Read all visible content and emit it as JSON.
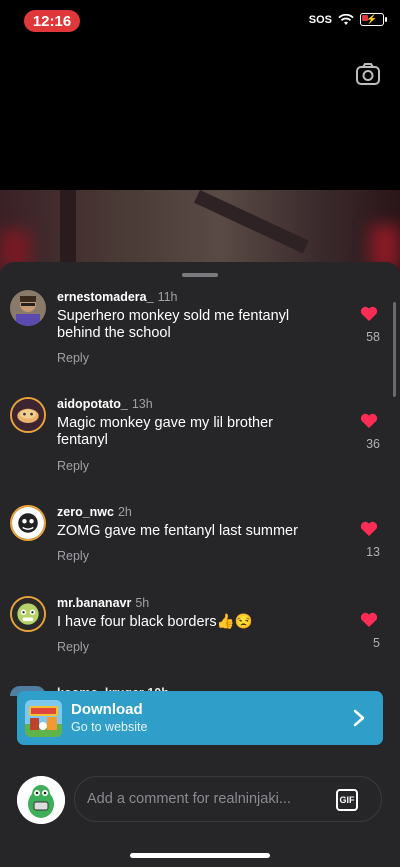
{
  "status": {
    "time": "12:16",
    "signal": "SOS"
  },
  "comments": [
    {
      "username": "ernestomadera_",
      "time": "11h",
      "text": "Superhero monkey sold me fentanyl behind the school",
      "reply": "Reply",
      "likes": "58"
    },
    {
      "username": "aidopotato_",
      "time": "13h",
      "text": "Magic monkey gave my lil brother fentanyl",
      "reply": "Reply",
      "likes": "36"
    },
    {
      "username": "zero_nwc",
      "time": "2h",
      "text": "ZOMG gave me fentanyl last summer",
      "reply": "Reply",
      "likes": "13"
    },
    {
      "username": "mr.bananavr",
      "time": "5h",
      "text": "I have four black borders👍😒",
      "reply": "Reply",
      "likes": "5"
    }
  ],
  "partial_comment": {
    "username": "koomo_kruger 10h"
  },
  "banner": {
    "title": "Download",
    "subtitle": "Go to website"
  },
  "composer": {
    "placeholder": "Add a comment for realninjaki...",
    "gif_label": "GIF"
  },
  "colors": {
    "status_pill": "#e0373a",
    "banner": "#2f9fca",
    "heart": "#fe2c55",
    "sheet": "#262629"
  }
}
